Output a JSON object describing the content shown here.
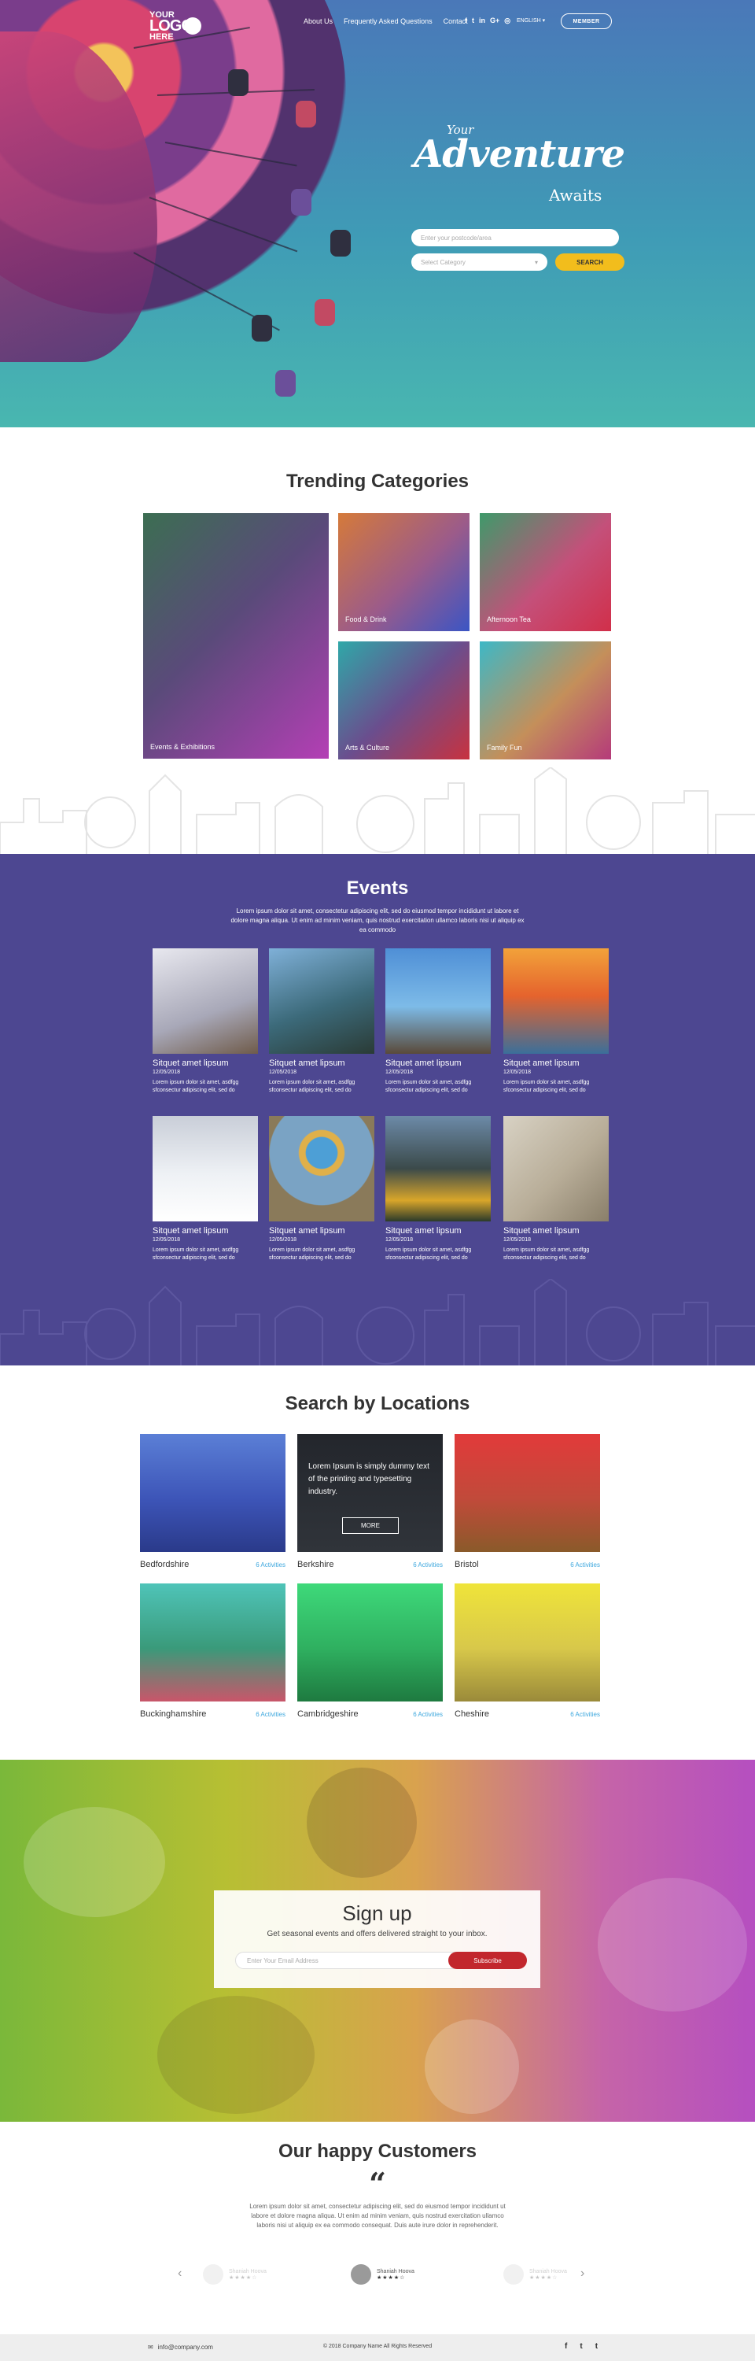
{
  "header": {
    "logo": {
      "line1": "YOUR",
      "line2": "LOGO",
      "line3": "HERE"
    },
    "nav": [
      "About Us",
      "Frequently Asked Questions",
      "Contact"
    ],
    "social_icons": [
      "facebook-icon",
      "twitter-icon",
      "linkedin-icon",
      "google-plus-icon",
      "instagram-icon"
    ],
    "language": "ENGLISH ▾",
    "member_button": "MEMBER"
  },
  "hero": {
    "tagline_small": "Your",
    "tagline_big": "Adventure",
    "tagline_end": "Awaits",
    "postcode_placeholder": "Enter your postcode/area",
    "category_placeholder": "Select Category",
    "search_button": "SEARCH"
  },
  "trending": {
    "title": "Trending Categories",
    "items": [
      {
        "label": "Events & Exhibitions"
      },
      {
        "label": "Food & Drink"
      },
      {
        "label": "Afternoon Tea"
      },
      {
        "label": "Arts & Culture"
      },
      {
        "label": "Family Fun"
      }
    ]
  },
  "events": {
    "title": "Events",
    "description": "Lorem ipsum dolor sit amet, consectetur adipiscing elit, sed do eiusmod tempor incididunt ut labore et dolore magna aliqua. Ut enim ad minim veniam, quis nostrud exercitation ullamco laboris nisi ut aliquip ex ea commodo",
    "items": [
      {
        "title": "Sitquet amet lipsum",
        "date": "12/05/2018",
        "text": "Lorem ipsum dolor sit amet, asdfgg sfconsectur adipiscing elit, sed do"
      },
      {
        "title": "Sitquet amet lipsum",
        "date": "12/05/2018",
        "text": "Lorem ipsum dolor sit amet, asdfgg sfconsectur adipiscing elit, sed do"
      },
      {
        "title": "Sitquet amet lipsum",
        "date": "12/05/2018",
        "text": "Lorem ipsum dolor sit amet, asdfgg sfconsectur adipiscing elit, sed do"
      },
      {
        "title": "Sitquet amet lipsum",
        "date": "12/05/2018",
        "text": "Lorem ipsum dolor sit amet, asdfgg sfconsectur adipiscing elit, sed do"
      },
      {
        "title": "Sitquet amet lipsum",
        "date": "12/05/2018",
        "text": "Lorem ipsum dolor sit amet, asdfgg sfconsectur adipiscing elit, sed do"
      },
      {
        "title": "Sitquet amet lipsum",
        "date": "12/05/2018",
        "text": "Lorem ipsum dolor sit amet, asdfgg sfconsectur adipiscing elit, sed do"
      },
      {
        "title": "Sitquet amet lipsum",
        "date": "12/05/2018",
        "text": "Lorem ipsum dolor sit amet, asdfgg sfconsectur adipiscing elit, sed do"
      },
      {
        "title": "Sitquet amet lipsum",
        "date": "12/05/2018",
        "text": "Lorem ipsum dolor sit amet, asdfgg sfconsectur adipiscing elit, sed do"
      }
    ]
  },
  "locations": {
    "title": "Search by Locations",
    "overlay_text": "Lorem Ipsum is simply dummy text of the printing and typesetting industry.",
    "more_button": "MORE",
    "items": [
      {
        "name": "Bedfordshire",
        "count": "6 Activities"
      },
      {
        "name": "Berkshire",
        "count": "6 Activities"
      },
      {
        "name": "Bristol",
        "count": "6 Activities"
      },
      {
        "name": "Buckinghamshire",
        "count": "6 Activities"
      },
      {
        "name": "Cambridgeshire",
        "count": "6 Activities"
      },
      {
        "name": "Cheshire",
        "count": "6 Activities"
      }
    ]
  },
  "signup": {
    "title": "Sign up",
    "description": "Get seasonal events and offers delivered straight to your inbox.",
    "email_placeholder": "Enter Your Email Address",
    "button": "Subscribe"
  },
  "customers": {
    "title": "Our happy Customers",
    "quote_mark": "“",
    "quote": "Lorem ipsum dolor sit amet, consectetur adipiscing elit, sed do eiusmod tempor incididunt ut labore et dolore magna aliqua. Ut enim ad minim veniam, quis nostrud exercitation ullamco laboris nisi ut aliquip ex ea commodo consequat. Duis aute irure dolor in reprehenderit.",
    "featured_name": "Shaniah Hoova",
    "faded_name": "Shaniah Hoova",
    "stars": "★★★★☆"
  },
  "footer": {
    "email": "info@company.com",
    "copyright": "© 2018 Company Name All Rights Reserved",
    "social": [
      "f",
      "t",
      "t"
    ]
  }
}
